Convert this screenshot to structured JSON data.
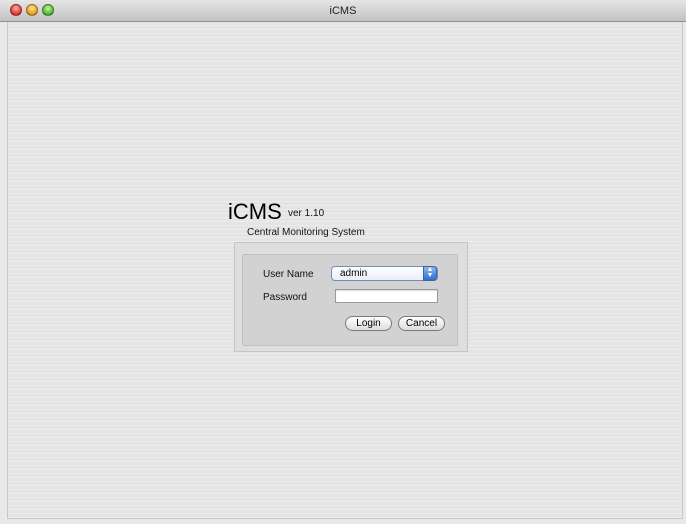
{
  "window": {
    "title": "iCMS"
  },
  "app": {
    "name": "iCMS",
    "version": "ver 1.10",
    "subtitle": "Central Monitoring System"
  },
  "login_form": {
    "username_label": "User Name",
    "username_value": "admin",
    "password_label": "Password",
    "password_value": "",
    "login_label": "Login",
    "cancel_label": "Cancel"
  }
}
